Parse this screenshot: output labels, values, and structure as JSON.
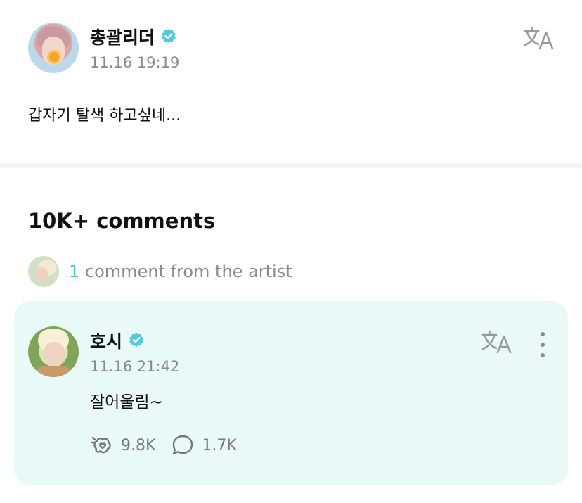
{
  "post": {
    "author": "총괄리더",
    "time": "11.16 19:19",
    "text": "갑자기 탈색 하고싶네..."
  },
  "comments": {
    "count_label": "10K+ comments",
    "artist_count": "1",
    "artist_label": " comment from the artist"
  },
  "artist_comment": {
    "author": "호시",
    "time": "11.16 21:42",
    "text": "잘어울림~",
    "likes": "9.8K",
    "replies": "1.7K"
  },
  "colors": {
    "accent": "#4fc8c6",
    "card_bg": "#e9faf6",
    "muted": "#8a8a8a"
  },
  "icons": [
    "verified-badge-icon",
    "translate-icon",
    "more-vertical-icon",
    "like-icon",
    "reply-icon"
  ]
}
